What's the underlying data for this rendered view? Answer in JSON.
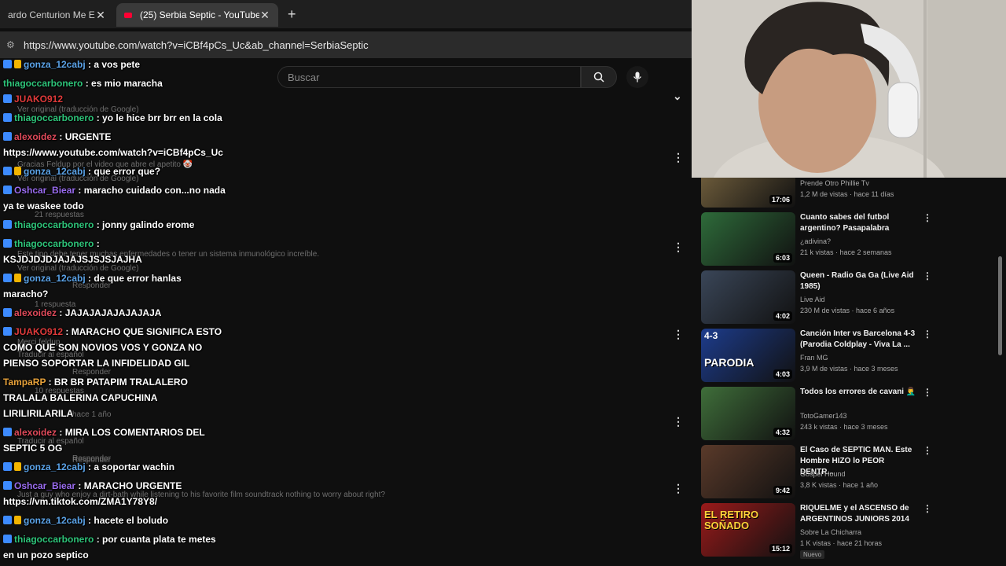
{
  "tabs": [
    {
      "title": "ardo Centurion Me Enc"
    },
    {
      "title": "(25) Serbia Septic - YouTube"
    }
  ],
  "new_tab": "+",
  "url": "https://www.youtube.com/watch?v=iCBf4pCs_Uc&ab_channel=SerbiaSeptic",
  "search": {
    "placeholder": "Buscar"
  },
  "ghost_texts": [
    "Ver original (traducción de Google)",
    "Gracias Feldup por el video que abre el apetito 🤡",
    "Ver original (traducción de Google)",
    "21 respuestas",
    "Este tipo debe tener muchas enfermedades o tener un sistema inmunológico increíble.",
    "Ver original (traducción de Google)",
    "Responder",
    "1 respuesta",
    "Merci feldup",
    "Traducir al español",
    "Responder",
    "10 respuestas",
    "hace 1 año",
    "Traducir al español",
    "Responder",
    "Just a guy who enjoy a dirt-bath while listening to his favorite film soundtrack nothing to worry about right?",
    "Responder"
  ],
  "chat": [
    {
      "user": "gonza_12cabj",
      "color": "#5ba3e8",
      "badges": 2,
      "lines": [
        " : a vos pete"
      ]
    },
    {
      "user": "thiagoccarbonero",
      "color": "#2ec57a",
      "badges": 0,
      "lines": [
        " : es mio maracha"
      ]
    },
    {
      "user": "JUAKO912",
      "color": "#e03a3a",
      "badges": 1,
      "lines": [
        ""
      ]
    },
    {
      "user": "thiagoccarbonero",
      "color": "#2ec57a",
      "badges": 1,
      "lines": [
        " : yo le hice brr brr en la cola"
      ]
    },
    {
      "user": "alexoidez",
      "color": "#e04a5a",
      "badges": 1,
      "lines": [
        " : URGENTE",
        "https://www.youtube.com/watch?v=iCBf4pCs_Uc"
      ]
    },
    {
      "user": "gonza_12cabj",
      "color": "#5ba3e8",
      "badges": 2,
      "lines": [
        " : que error que?"
      ]
    },
    {
      "user": "Oshcar_Biear",
      "color": "#9a6cf0",
      "badges": 1,
      "lines": [
        " : maracho cuidado con...no nada",
        "ya te waskee todo"
      ]
    },
    {
      "user": "thiagoccarbonero",
      "color": "#2ec57a",
      "badges": 1,
      "lines": [
        " : jonny galindo erome"
      ]
    },
    {
      "user": "thiagoccarbonero",
      "color": "#2ec57a",
      "badges": 1,
      "lines": [
        " :",
        "KSJDJDJDJAJAJSJSJSJAJHA"
      ]
    },
    {
      "user": "gonza_12cabj",
      "color": "#5ba3e8",
      "badges": 2,
      "lines": [
        " : de que error hanlas",
        "maracho?"
      ]
    },
    {
      "user": "alexoidez",
      "color": "#e04a5a",
      "badges": 1,
      "lines": [
        " : JAJAJAJAJAJAJAJA"
      ]
    },
    {
      "user": "JUAKO912",
      "color": "#e03a3a",
      "badges": 1,
      "lines": [
        " : MARACHO QUE SIGNIFICA ESTO",
        "COMO QUE SON NOVIOS VOS Y GONZA NO",
        "PIENSO SOPORTAR LA INFIDELIDAD GIL"
      ]
    },
    {
      "user": "TampaRP",
      "color": "#e8a23a",
      "badges": 0,
      "lines": [
        " : BR BR PATAPIM TRALALERO",
        "TRALALA BALERINA CAPUCHINA",
        "LIRILIRILARILA"
      ]
    },
    {
      "user": "alexoidez",
      "color": "#e04a5a",
      "badges": 1,
      "lines": [
        " : MIRA LOS COMENTARIOS DEL",
        "SEPTIC 5 OG"
      ]
    },
    {
      "user": "gonza_12cabj",
      "color": "#5ba3e8",
      "badges": 2,
      "lines": [
        " : a soportar wachin"
      ]
    },
    {
      "user": "Oshcar_Biear",
      "color": "#9a6cf0",
      "badges": 1,
      "lines": [
        " : MARACHO URGENTE",
        "https://vm.tiktok.com/ZMA1Y78Y8/"
      ]
    },
    {
      "user": "gonza_12cabj",
      "color": "#5ba3e8",
      "badges": 2,
      "lines": [
        " : hacete el boludo"
      ]
    },
    {
      "user": "thiagoccarbonero",
      "color": "#2ec57a",
      "badges": 1,
      "lines": [
        " : por cuanta plata te metes",
        "en un pozo septico"
      ]
    }
  ],
  "videos": [
    {
      "title": "",
      "channel": "Prende Otro Phillie Tv",
      "meta": "1,2 M de vistas · hace 11 días",
      "duration": "17:06",
      "thumb": "#6b5a3a"
    },
    {
      "title": "Cuanto sabes del futbol argentino? Pasapalabra",
      "channel": "¿adivina?",
      "meta": "21 k vistas · hace 2 semanas",
      "duration": "6:03",
      "thumb": "#2e6b3a"
    },
    {
      "title": "Queen - Radio Ga Ga (Live Aid 1985)",
      "channel": "Live Aid",
      "meta": "230 M de vistas · hace 6 años",
      "duration": "4:02",
      "thumb": "#3a4658"
    },
    {
      "title": "Canción Inter vs Barcelona 4-3 (Parodia Coldplay - Viva La ...",
      "channel": "Fran MG",
      "meta": "3,9 M de vistas · hace 3 meses",
      "duration": "4:03",
      "thumb": "#1d3c8c",
      "label": "PARODIA",
      "score": "4-3"
    },
    {
      "title": "Todos los errores de cavani 🤦‍♂️",
      "channel": "TotoGamer143",
      "meta": "243 k vistas · hace 3 meses",
      "duration": "4:32",
      "thumb": "#3f6e3a"
    },
    {
      "title": "El Caso de SEPTIC MAN. Este Hombre HIZO lo PEOR DENTR...",
      "channel": "Gospel Hound",
      "meta": "3,8 K vistas · hace 1 año",
      "duration": "9:42",
      "thumb": "#5a3a2a"
    },
    {
      "title": "RIQUELME y el ASCENSO de ARGENTINOS JUNIORS 2014",
      "channel": "Sobre La Chicharra",
      "meta": "1 K vistas · hace 21 horas",
      "duration": "15:12",
      "thumb": "#9a1a1a",
      "label": "EL RETIRO SOÑADO",
      "badge": "Nuevo"
    }
  ],
  "colors": {
    "accent": "#ff0033",
    "bg": "#0f0f0f"
  }
}
